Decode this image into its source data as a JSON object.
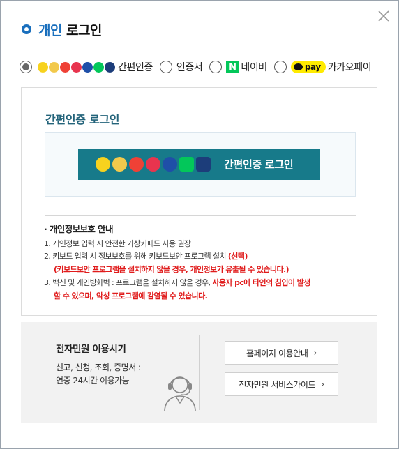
{
  "dialog": {
    "title_accent": "개인",
    "title_rest": "로그인",
    "close_icon": "close-icon"
  },
  "methods": {
    "options": [
      {
        "label": "간편인증",
        "selected": true
      },
      {
        "label": "인증서",
        "selected": false
      },
      {
        "label": "네이버",
        "selected": false,
        "badge": "N"
      },
      {
        "label": "카카오페이",
        "selected": false,
        "badge": "pay"
      }
    ]
  },
  "panel": {
    "title": "간편인증 로그인",
    "button_label": "간편인증 로그인",
    "provider_logos": [
      "kakao",
      "toss",
      "payco",
      "pass",
      "samsung-pass",
      "naver",
      "shinhan"
    ]
  },
  "notice": {
    "heading": "· 개인정보보호 안내",
    "line1": "1. 개인정보 입력 시 안전한 가상키패드 사용 권장",
    "line2": "2. 키보드 입력 시 정보보호를 위해 키보드보안 프로그램 설치",
    "line2_red": "(선택)",
    "line3_red": "(키보드보안 프로그램을 설치하지 않을 경우, 개인정보가 유출될 수 있습니다.)",
    "line4": "3. 백신 및 개인방화벽 : 프로그램을 설치하지 않을 경우,",
    "line4_red": "사용자 pc에 타인의 침입이 발생",
    "line5_red": "할 수 있으며, 악성 프로그램에 감염될 수 있습니다."
  },
  "service": {
    "title": "전자민원 이용시기",
    "subtitle": "신고, 신청, 조회, 증명서 :",
    "value": "연중 24시간 이용가능",
    "btn_guide": "홈페이지 이용안내",
    "btn_service": "전자민원 서비스가이드"
  },
  "colors": {
    "accent_blue": "#1a6fbd",
    "teal_button": "#177a8a",
    "warning_red": "#e01b1b",
    "naver_green": "#03c75a",
    "kakao_yellow": "#ffeb00"
  }
}
